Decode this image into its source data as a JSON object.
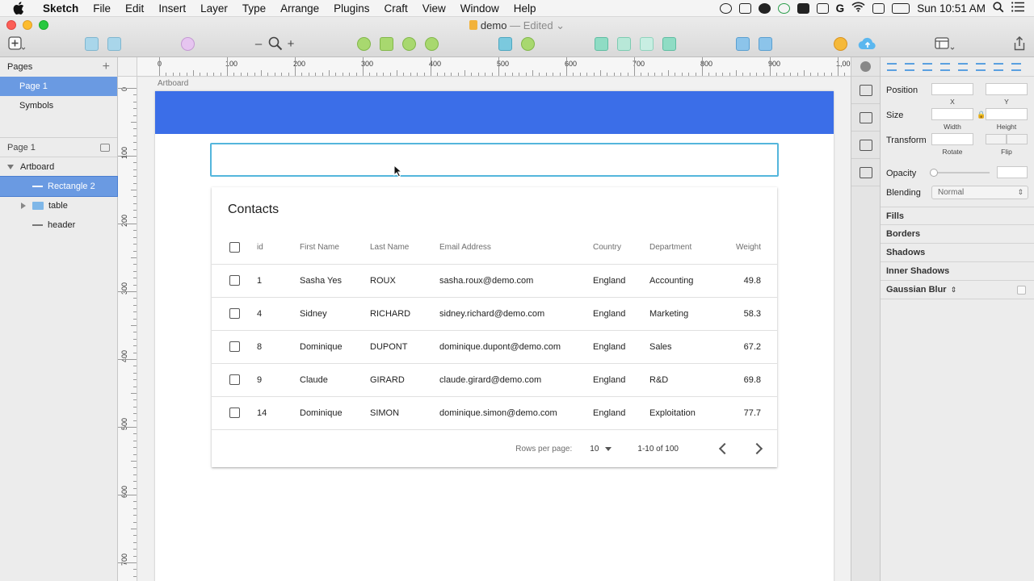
{
  "menubar": {
    "app": "Sketch",
    "items": [
      "File",
      "Edit",
      "Insert",
      "Layer",
      "Type",
      "Arrange",
      "Plugins",
      "Craft",
      "View",
      "Window",
      "Help"
    ],
    "clock": "Sun 10:51 AM"
  },
  "window": {
    "doc_name": "demo",
    "edited": "— Edited"
  },
  "toolbar": {
    "zoom_minus": "–",
    "zoom_plus": "+"
  },
  "sidebar": {
    "pages_header": "Pages",
    "pages": [
      "Page 1",
      "Symbols"
    ],
    "layers_header": "Page 1",
    "layers": [
      "Artboard",
      "Rectangle 2",
      "table",
      "header"
    ]
  },
  "rulers": {
    "top": [
      "0",
      "100",
      "200",
      "300",
      "400",
      "500",
      "600",
      "700",
      "800",
      "900",
      "1,00"
    ],
    "left": [
      "0",
      "100",
      "200",
      "300",
      "400",
      "500",
      "600",
      "700"
    ]
  },
  "canvas": {
    "artboard_label": "Artboard",
    "header_color": "#3b6ee8",
    "selection_color": "#54b6dc"
  },
  "contacts": {
    "title": "Contacts",
    "columns": [
      "id",
      "First Name",
      "Last Name",
      "Email Address",
      "Country",
      "Department",
      "Weight"
    ],
    "rows": [
      [
        "1",
        "Sasha Yes",
        "ROUX",
        "sasha.roux@demo.com",
        "England",
        "Accounting",
        "49.8"
      ],
      [
        "4",
        "Sidney",
        "RICHARD",
        "sidney.richard@demo.com",
        "England",
        "Marketing",
        "58.3"
      ],
      [
        "8",
        "Dominique",
        "DUPONT",
        "dominique.dupont@demo.com",
        "England",
        "Sales",
        "67.2"
      ],
      [
        "9",
        "Claude",
        "GIRARD",
        "claude.girard@demo.com",
        "England",
        "R&D",
        "69.8"
      ],
      [
        "14",
        "Dominique",
        "SIMON",
        "dominique.simon@demo.com",
        "England",
        "Exploitation",
        "77.7"
      ]
    ],
    "pager": {
      "rows_label": "Rows per page:",
      "rows_value": "10",
      "range": "1-10 of 100"
    }
  },
  "inspector": {
    "position": "Position",
    "x": "X",
    "y": "Y",
    "size": "Size",
    "width": "Width",
    "height": "Height",
    "transform": "Transform",
    "rotate": "Rotate",
    "flip": "Flip",
    "opacity": "Opacity",
    "blending": "Blending",
    "blending_value": "Normal",
    "sections": [
      "Fills",
      "Borders",
      "Shadows",
      "Inner Shadows",
      "Gaussian Blur"
    ]
  }
}
